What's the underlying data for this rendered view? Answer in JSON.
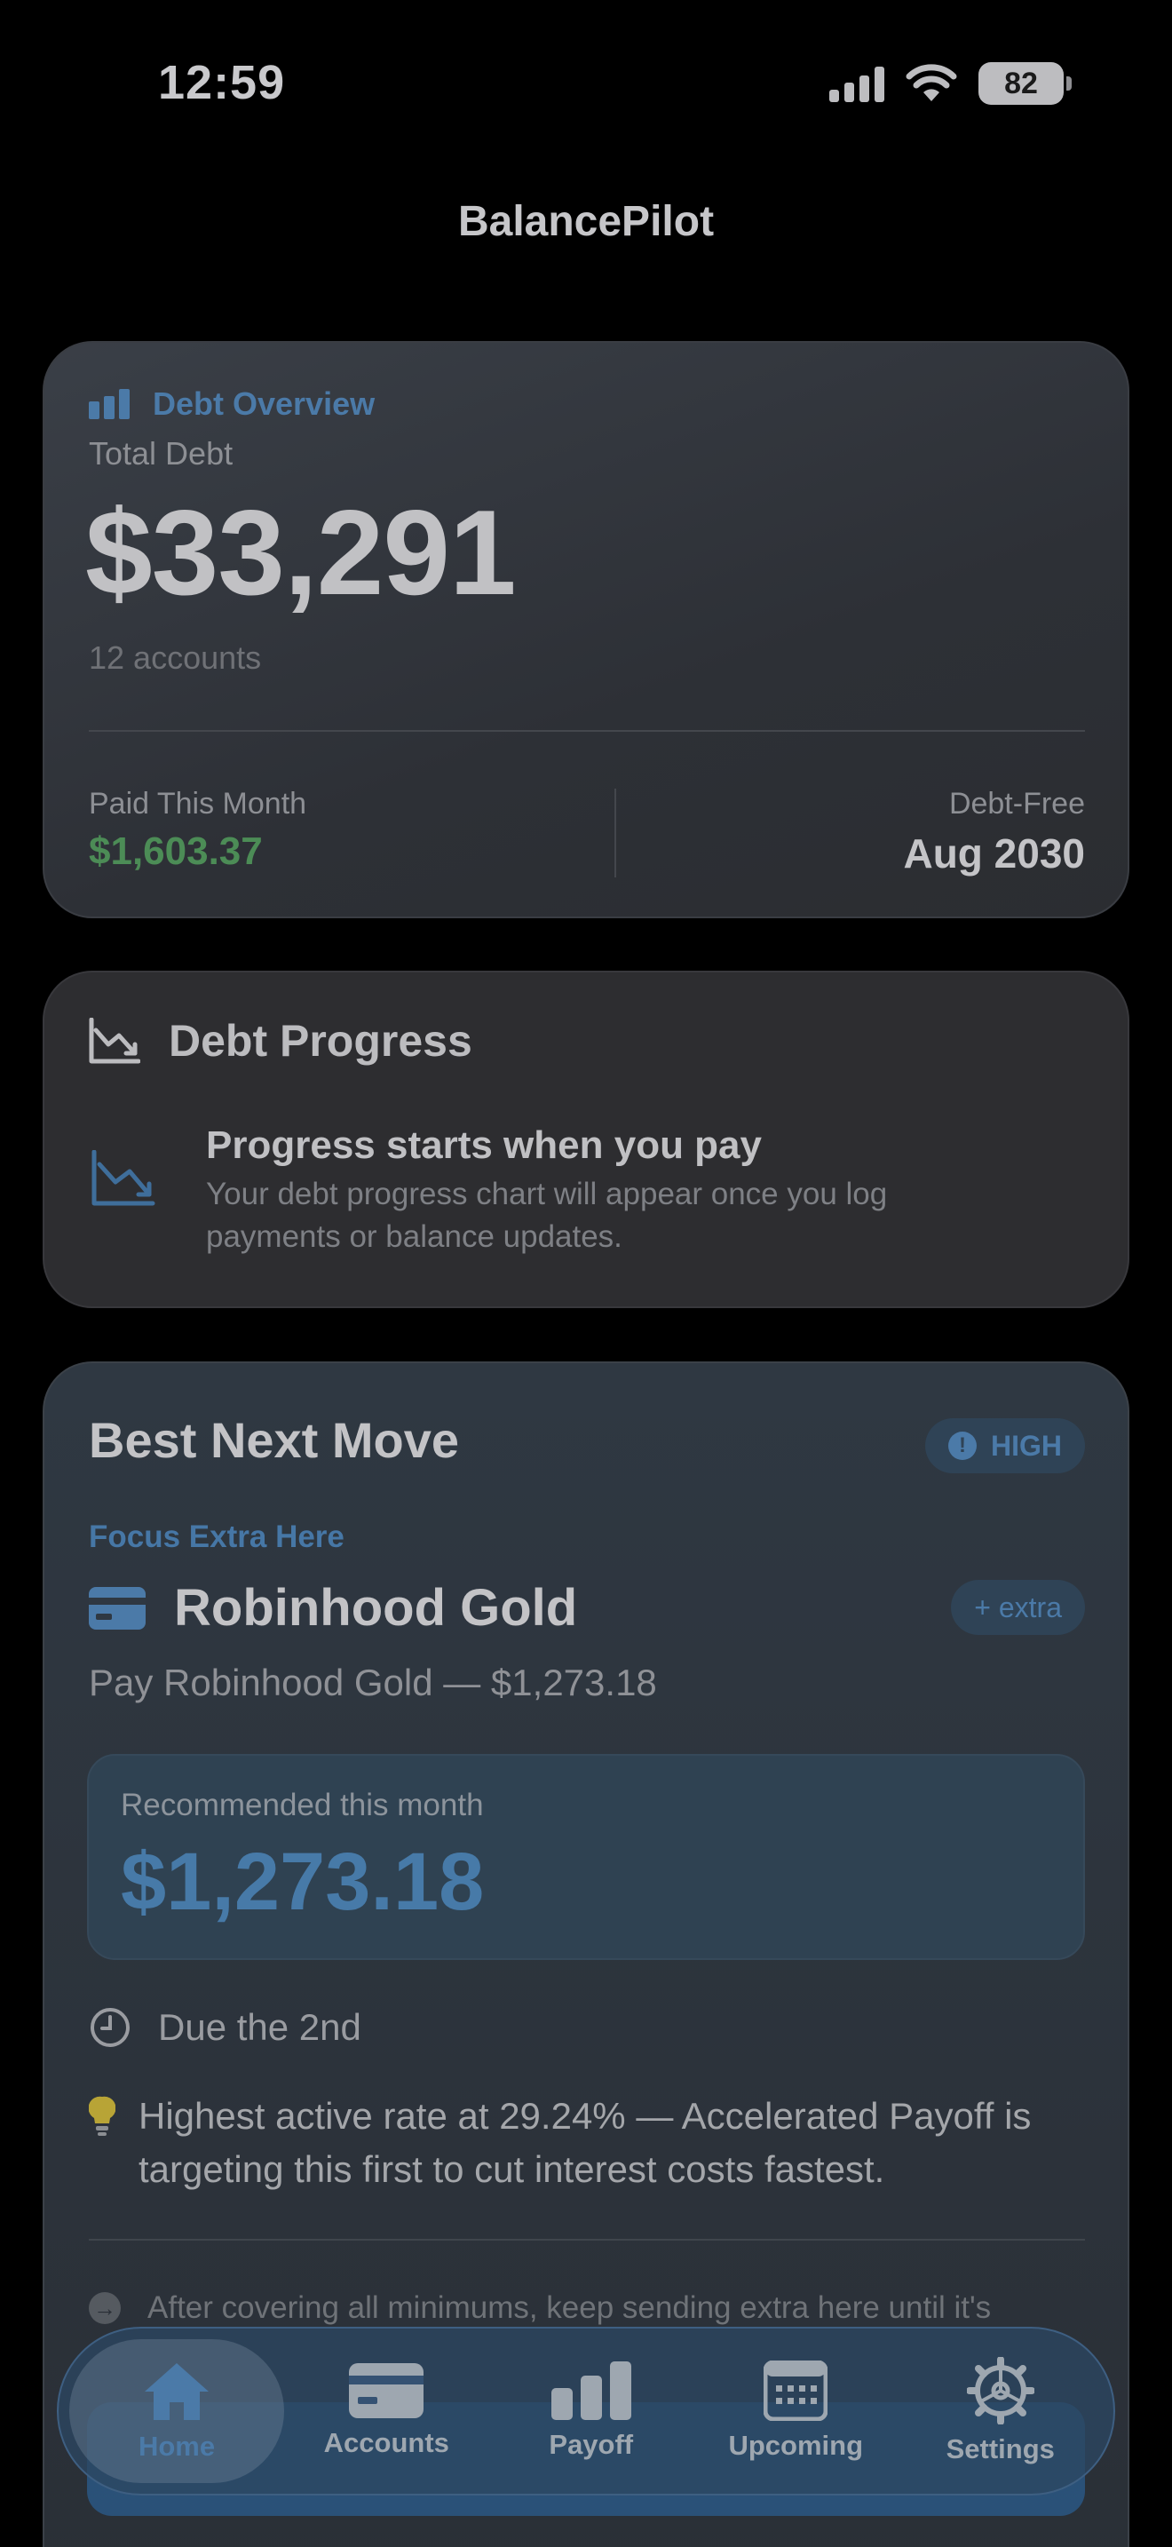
{
  "status_bar": {
    "time": "12:59",
    "battery": "82"
  },
  "app": {
    "title": "BalancePilot"
  },
  "overview": {
    "header": "Debt Overview",
    "total_label": "Total Debt",
    "total_amount": "$33,291",
    "accounts": "12 accounts",
    "paid_label": "Paid This Month",
    "paid_value": "$1,603.37",
    "free_label": "Debt-Free",
    "free_value": "Aug 2030",
    "accent_color": "#4b7aa8",
    "paid_color": "#4c8c56"
  },
  "progress": {
    "title": "Debt Progress",
    "empty_title": "Progress starts when you pay",
    "empty_body": "Your debt progress chart will appear once you log payments or balance updates."
  },
  "best_move": {
    "title": "Best Next Move",
    "priority": "HIGH",
    "focus_label": "Focus Extra Here",
    "account_name": "Robinhood Gold",
    "extra_badge": "+ extra",
    "pay_line": "Pay Robinhood Gold — $1,273.18",
    "recommended_label": "Recommended this month",
    "recommended_amount": "$1,273.18",
    "due": "Due the 2nd",
    "reason": "Highest active rate at 29.24% — Accelerated Payoff is targeting this first to cut interest costs fastest.",
    "after": "After covering all minimums, keep sending extra here until it's"
  },
  "tabs": [
    {
      "label": "Home",
      "icon": "house-icon",
      "active": true
    },
    {
      "label": "Accounts",
      "icon": "card-icon"
    },
    {
      "label": "Payoff",
      "icon": "bar-chart-icon"
    },
    {
      "label": "Upcoming",
      "icon": "calendar-icon"
    },
    {
      "label": "Settings",
      "icon": "gear-icon"
    }
  ]
}
